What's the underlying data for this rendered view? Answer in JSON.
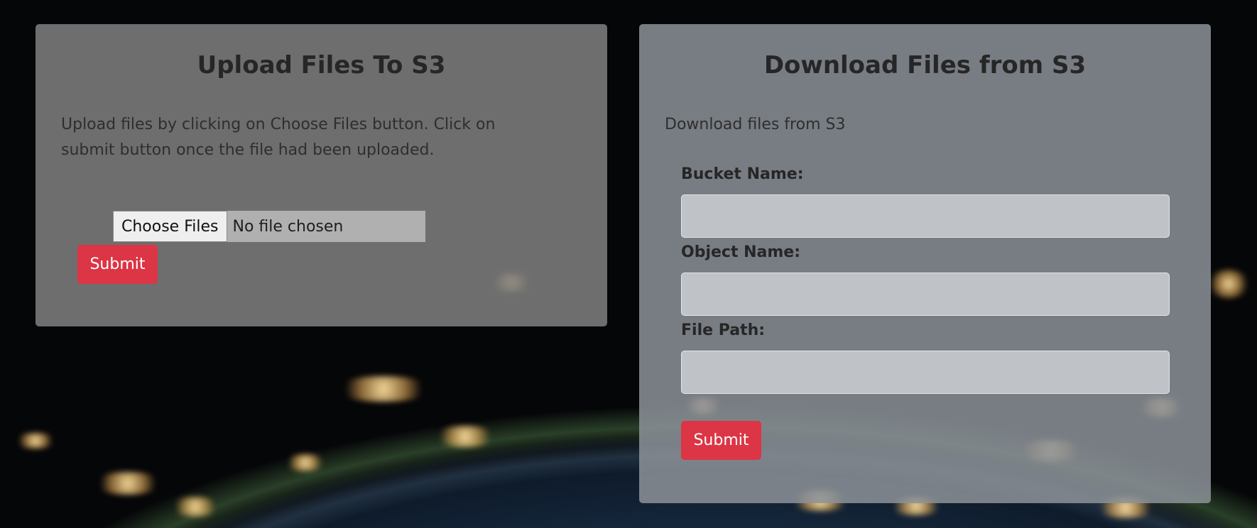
{
  "upload": {
    "title": "Upload Files To S3",
    "description": "Upload files by clicking on Choose Files button. Click on submit button once the file had been uploaded.",
    "file_button_label": "Choose Files",
    "file_status": "No file chosen",
    "submit_label": "Submit"
  },
  "download": {
    "title": "Download Files from S3",
    "description": "Download files from S3",
    "bucket_label": "Bucket Name:",
    "bucket_value": "",
    "object_label": "Object Name:",
    "object_value": "",
    "path_label": "File Path:",
    "path_value": "",
    "submit_label": "Submit"
  },
  "colors": {
    "submit_button": "#dc3545",
    "card_background": "#808080"
  }
}
